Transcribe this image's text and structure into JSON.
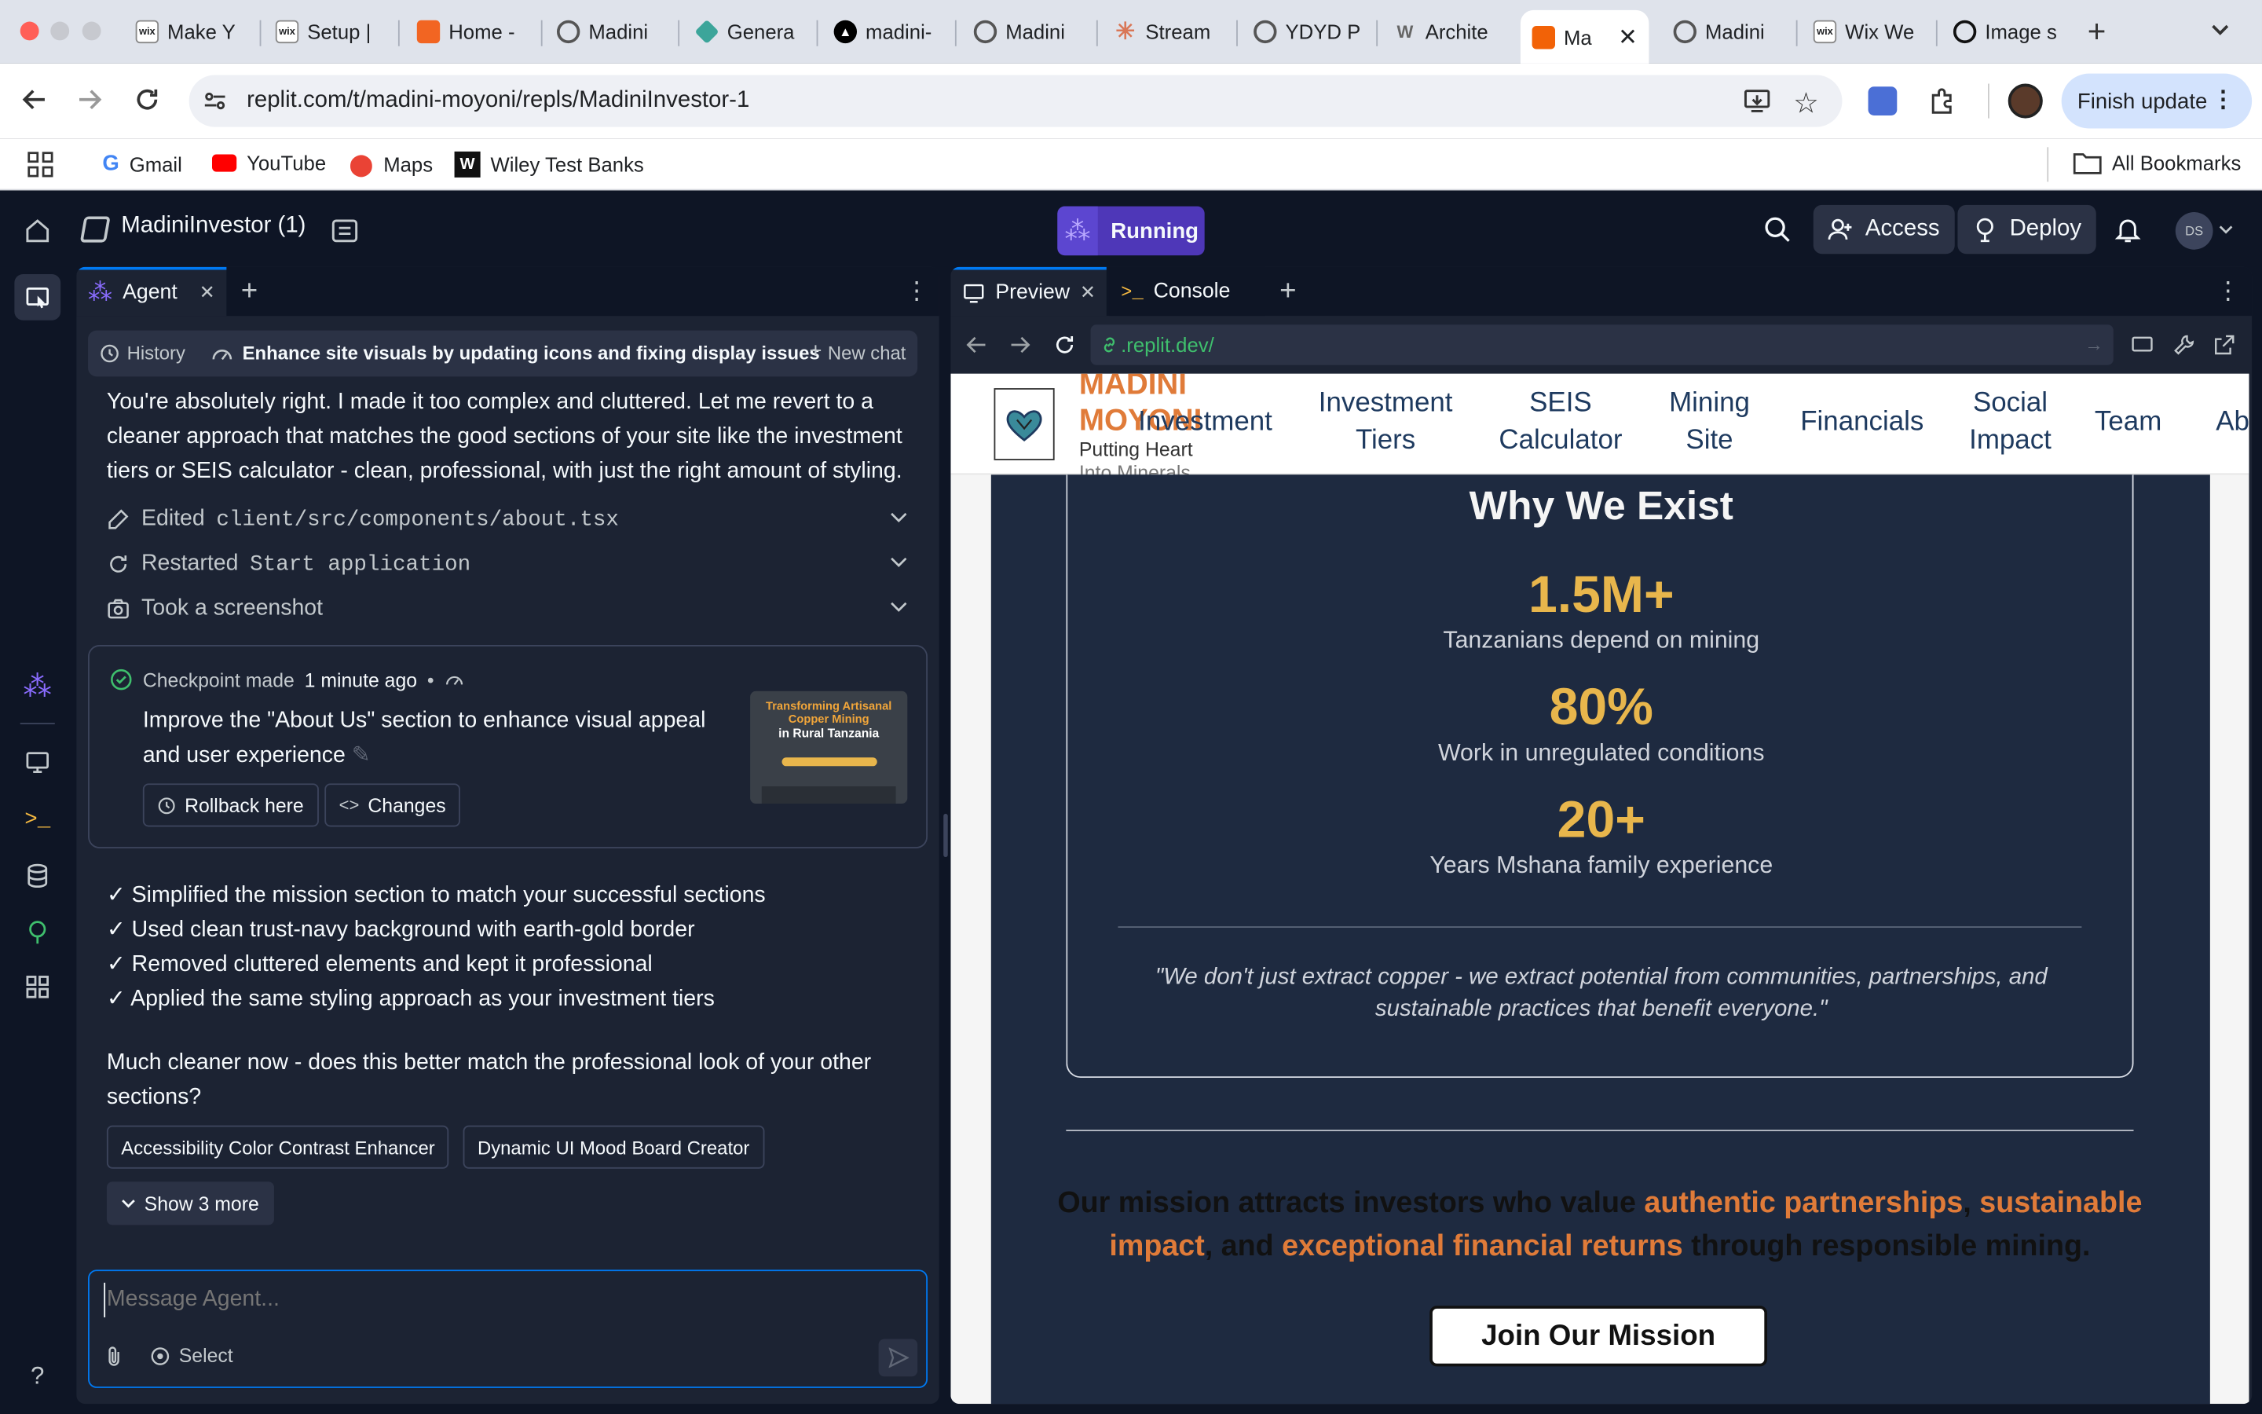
{
  "browser": {
    "tabs": [
      {
        "label": "Make Y",
        "icon": "wix-icon"
      },
      {
        "label": "Setup |",
        "icon": "wix-icon"
      },
      {
        "label": "Home -",
        "icon": "orange-square-icon"
      },
      {
        "label": "Madini",
        "icon": "globe-icon"
      },
      {
        "label": "Genera",
        "icon": "diamond-icon"
      },
      {
        "label": "madini-",
        "icon": "triangle-icon"
      },
      {
        "label": "Madini",
        "icon": "globe-icon"
      },
      {
        "label": "Stream",
        "icon": "asterisk-icon"
      },
      {
        "label": "YDYD P",
        "icon": "globe-icon"
      },
      {
        "label": "Archite",
        "icon": "w-icon"
      },
      {
        "label": "Ma",
        "icon": "replit-icon"
      },
      {
        "label": "Madini",
        "icon": "globe-icon"
      },
      {
        "label": "Wix We",
        "icon": "wix-icon"
      },
      {
        "label": "Image s",
        "icon": "openai-icon"
      }
    ],
    "url": "replit.com/t/madini-moyoni/repls/MadiniInvestor-1",
    "finish_update": "Finish update",
    "bookmarks": [
      "Gmail",
      "YouTube",
      "Maps",
      "Wiley Test Banks"
    ],
    "all_bookmarks": "All Bookmarks"
  },
  "replit": {
    "project_name": "MadiniInvestor (1)",
    "run_status": "Running",
    "access_label": "Access",
    "deploy_label": "Deploy",
    "avatar_initials": "DS",
    "agent_tab": "Agent",
    "preview_tab": "Preview",
    "console_tab": "Console",
    "history_label": "History",
    "chat_title": "Enhance site visuals by updating icons and fixing display issues",
    "new_chat_label": "New chat",
    "intro": "You're absolutely right. I made it too complex and cluttered. Let me revert to a cleaner approach that matches the good sections of your site like the investment tiers or SEIS calculator - clean, professional, with just the right amount of styling.",
    "actions": [
      {
        "verb": "Edited",
        "target": "client/src/components/about.tsx"
      },
      {
        "verb": "Restarted",
        "target": "Start application"
      },
      {
        "verb": "Took a screenshot",
        "target": ""
      }
    ],
    "checkpoint": {
      "made_label": "Checkpoint made",
      "time": "1 minute ago",
      "bullet": "•",
      "description": "Improve the \"About Us\" section to enhance visual appeal and user experience",
      "rollback_label": "Rollback here",
      "changes_label": "Changes",
      "thumb_title": "Transforming Artisanal Copper Mining",
      "thumb_subtitle": "in Rural Tanzania"
    },
    "summary": [
      "✓ Simplified the mission section to match your successful sections",
      "✓ Used clean trust-navy background with earth-gold border",
      "✓ Removed cluttered elements and kept it professional",
      "✓ Applied the same styling approach as your investment tiers"
    ],
    "closing": "Much cleaner now - does this better match the professional look of your other sections?",
    "suggestions": [
      "Accessibility Color Contrast Enhancer",
      "Dynamic UI Mood Board Creator"
    ],
    "show_more": "Show 3 more",
    "message_placeholder": "Message Agent...",
    "select_label": "Select",
    "preview_url": ".replit.dev/"
  },
  "site": {
    "brand_line1": "MADINI",
    "brand_line2": "MOYONI",
    "tagline_line1": "Putting Heart",
    "tagline_line2": "Into Minerals",
    "nav": [
      [
        "Investment"
      ],
      [
        "Investment",
        "Tiers"
      ],
      [
        "SEIS",
        "Calculator"
      ],
      [
        "Mining",
        "Site"
      ],
      [
        "Financials"
      ],
      [
        "Social",
        "Impact"
      ],
      [
        "Team"
      ],
      [
        "Ab"
      ]
    ],
    "section_title": "Why We Exist",
    "stats": [
      {
        "value": "1.5M+",
        "label": "Tanzanians depend on mining"
      },
      {
        "value": "80%",
        "label": "Work in unregulated conditions"
      },
      {
        "value": "20+",
        "label": "Years Mshana family experience"
      }
    ],
    "quote": "\"We don't just extract copper - we extract potential from communities, partnerships, and sustainable practices that benefit everyone.\"",
    "mission": {
      "before": "Our mission attracts investors who value ",
      "h1": "authentic partnerships",
      "sep1": ", ",
      "h2": "sustainable impact",
      "sep2": ", and ",
      "h3": "exceptional financial returns",
      "after": " through responsible mining."
    },
    "cta": "Join Our Mission",
    "colors": {
      "gold": "#e8b64c",
      "orange": "#e07b39",
      "navy": "#1e2a40"
    }
  }
}
